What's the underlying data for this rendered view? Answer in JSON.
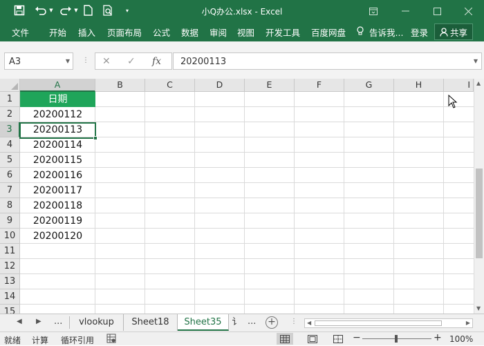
{
  "window": {
    "title": "小Q办公.xlsx - Excel"
  },
  "ribbon": {
    "tabs": [
      "文件",
      "开始",
      "插入",
      "页面布局",
      "公式",
      "数据",
      "审阅",
      "视图",
      "开发工具",
      "百度网盘"
    ],
    "tell_me": "告诉我...",
    "login": "登录",
    "share": "共享"
  },
  "formula_bar": {
    "name_box": "A3",
    "formula": "20200113",
    "fx": "fx"
  },
  "grid": {
    "columns": [
      "A",
      "B",
      "C",
      "D",
      "E",
      "F",
      "G",
      "H",
      "I"
    ],
    "rows": [
      "1",
      "2",
      "3",
      "4",
      "5",
      "6",
      "7",
      "8",
      "9",
      "10",
      "11",
      "12",
      "13",
      "14",
      "15"
    ],
    "selected_cell": "A3",
    "column_a": [
      "日期",
      "20200112",
      "20200113",
      "20200114",
      "20200115",
      "20200116",
      "20200117",
      "20200118",
      "20200119",
      "20200120"
    ]
  },
  "sheet_tabs": {
    "ellipsis": "...",
    "tabs": [
      "vlookup",
      "Sheet18",
      "Sheet35"
    ],
    "active": "Sheet35",
    "partial_tab": "讠"
  },
  "status_bar": {
    "ready": "就绪",
    "calc": "计算",
    "circular": "循环引用",
    "zoom": "100%"
  },
  "colors": {
    "brand_green": "#217346",
    "header_fill": "#1fa55a"
  }
}
